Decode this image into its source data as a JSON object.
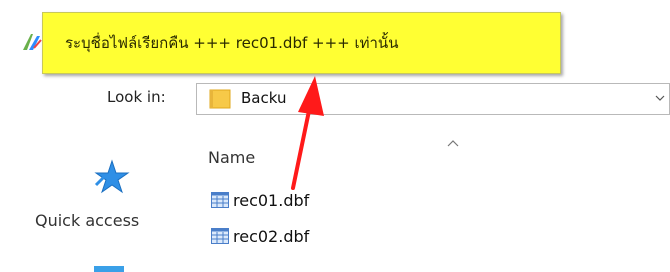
{
  "callout": {
    "text": "ระบุชื่อไฟล์เรียกคืน +++ rec01.dbf +++ เท่านั้น",
    "background": "#ffff33"
  },
  "dialog": {
    "look_in_label": "Look in:",
    "look_in_value": "Backu",
    "column_name_header": "Name"
  },
  "files": [
    {
      "name": "rec01.dbf",
      "icon": "dbf-file-icon"
    },
    {
      "name": "rec02.dbf",
      "icon": "dbf-file-icon"
    }
  ],
  "sidebar": {
    "quick_access_label": "Quick access"
  },
  "colors": {
    "accent": "#3aa0e8",
    "arrow": "#ff1a1a"
  }
}
